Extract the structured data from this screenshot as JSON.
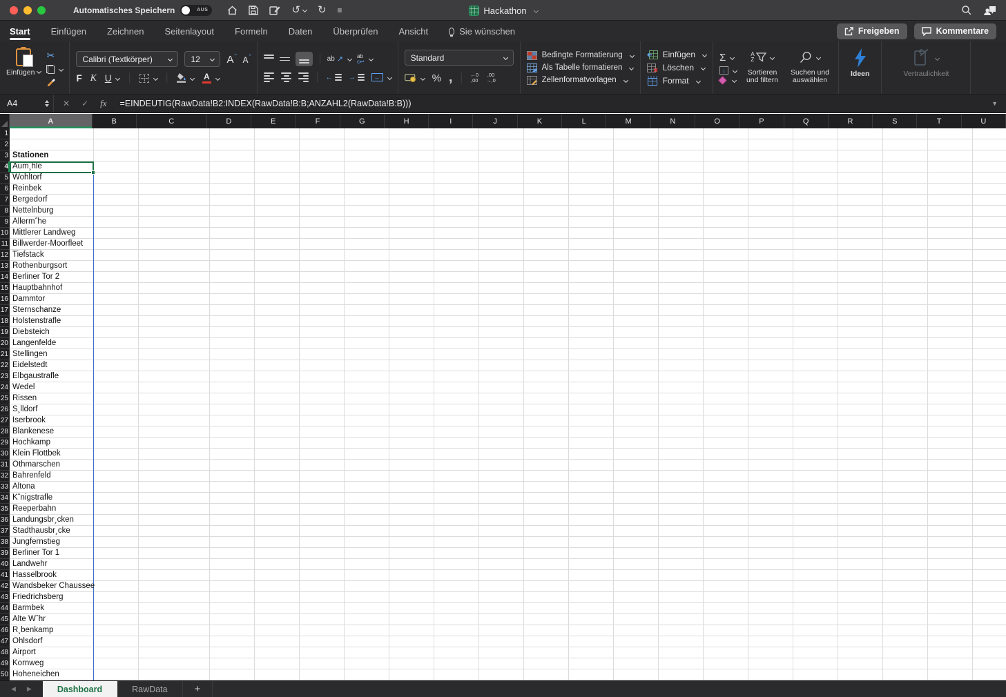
{
  "titlebar": {
    "autosave_label": "Automatisches Speichern",
    "autosave_state": "AUS",
    "doc_title": "Hackathon"
  },
  "ribbon_tabs": [
    {
      "label": "Start",
      "active": true
    },
    {
      "label": "Einfügen"
    },
    {
      "label": "Zeichnen"
    },
    {
      "label": "Seitenlayout"
    },
    {
      "label": "Formeln"
    },
    {
      "label": "Daten"
    },
    {
      "label": "Überprüfen"
    },
    {
      "label": "Ansicht"
    },
    {
      "label": "Sie wünschen",
      "bulb": true
    }
  ],
  "actions": {
    "share_label": "Freigeben",
    "comments_label": "Kommentare"
  },
  "ribbon": {
    "clipboard": {
      "paste_label": "Einfügen"
    },
    "font": {
      "name": "Calibri (Textkörper)",
      "size": "12",
      "bold_glyph": "F",
      "italic_glyph": "K",
      "underline_glyph": "U"
    },
    "number": {
      "format": "Standard",
      "percent_glyph": "%",
      "comma_glyph": ",",
      "inc_dec_top": "←0",
      "inc_dec_bottom": ",00",
      "dec_dec_top": ",00",
      "dec_dec_bottom": "→,0"
    },
    "styles": [
      "Bedingte Formatierung",
      "Als Tabelle formatieren",
      "Zellenformatvorlagen"
    ],
    "cells": [
      "Einfügen",
      "Löschen",
      "Format"
    ],
    "editing": {
      "sum_glyph": "Σ",
      "sort_label": "Sortieren und filtern",
      "find_label": "Suchen und auswählen"
    },
    "ideas_label": "Ideen",
    "sensitivity_label": "Vertraulichkeit"
  },
  "formula_bar": {
    "cell_ref": "A4",
    "formula": "=EINDEUTIG(RawData!B2:INDEX(RawData!B:B;ANZAHL2(RawData!B:B)))"
  },
  "grid": {
    "columns": [
      "A",
      "B",
      "C",
      "D",
      "E",
      "F",
      "G",
      "H",
      "I",
      "J",
      "K",
      "L",
      "M",
      "N",
      "O",
      "P",
      "Q",
      "R",
      "S",
      "T",
      "U"
    ],
    "selected_cell": "A4",
    "bold_rows": [
      3
    ],
    "rows": [
      "",
      "",
      "Stationen",
      "Aum¸hle",
      "Wohltorf",
      "Reinbek",
      "Bergedorf",
      "Nettelnburg",
      "Allermˆhe",
      "Mittlerer Landweg",
      "Billwerder-Moorfleet",
      "Tiefstack",
      "Rothenburgsort",
      "Berliner Tor 2",
      "Hauptbahnhof",
      "Dammtor",
      "Sternschanze",
      "Holstenstrafle",
      "Diebsteich",
      "Langenfelde",
      "Stellingen",
      "Eidelstedt",
      "Elbgaustrafle",
      "Wedel",
      "Rissen",
      "S¸lldorf",
      "Iserbrook",
      "Blankenese",
      "Hochkamp",
      "Klein Flottbek",
      "Othmarschen",
      "Bahrenfeld",
      "Altona",
      "Kˆnigstrafle",
      "Reeperbahn",
      "Landungsbr¸cken",
      "Stadthausbr¸cke",
      "Jungfernstieg",
      "Berliner Tor 1",
      "Landwehr",
      "Hasselbrook",
      "Wandsbeker Chaussee",
      "Friedrichsberg",
      "Barmbek",
      "Alte Wˆhr",
      "R¸benkamp",
      "Ohlsdorf",
      "Airport",
      "Kornweg",
      "Hoheneichen"
    ]
  },
  "sheet_tabs": [
    {
      "label": "Dashboard",
      "active": true
    },
    {
      "label": "RawData"
    }
  ],
  "icons": {
    "undo": "↺",
    "redo": "↻",
    "scissors": "✂",
    "menu": "≡",
    "prev": "◀",
    "next": "▶",
    "plus": "+",
    "cancel": "✕",
    "enter": "✓",
    "formula_fx": "fx",
    "expand": "▼",
    "orient": "ab",
    "orient_arrow": "↗",
    "wrap_a": "ab",
    "wrap_b": "c↩",
    "indent_out": "←",
    "indent_in": "→",
    "merge_arrow": "↔",
    "fill_down_arrow": "↓",
    "sort_a": "A",
    "sort_z": "Z",
    "align_increase": "A",
    "align_decrease": "A"
  },
  "colors": {
    "accent_green": "#1f7245",
    "header_underline": "#21915a",
    "page_break_blue": "#3b6cc7",
    "font_color_red": "#e23b2e",
    "ideas_blue": "#2e7fd6"
  }
}
